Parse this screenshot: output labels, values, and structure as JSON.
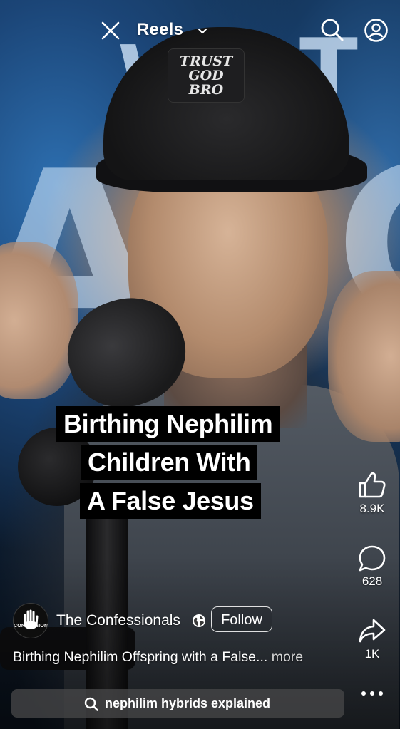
{
  "topbar": {
    "title": "Reels",
    "icons": [
      "close-icon",
      "chevron-down-icon",
      "search-icon",
      "profile-icon"
    ]
  },
  "video": {
    "cap_text": "TRUST\nGOD\nBRO",
    "background_letters": [
      "W",
      "A",
      "T",
      "T",
      "C"
    ]
  },
  "caption": {
    "lines": [
      "Birthing Nephilim",
      "Children With",
      "A False Jesus"
    ]
  },
  "actions": {
    "like": {
      "icon": "thumbs-up-icon",
      "count": "8.9K"
    },
    "comment": {
      "icon": "comment-icon",
      "count": "628"
    },
    "share": {
      "icon": "share-icon",
      "count": "1K"
    },
    "more": {
      "icon": "more-icon"
    }
  },
  "author": {
    "name": "The Confessionals",
    "avatar_text": "CONFESSIONALS",
    "follow_label": "Follow",
    "privacy_icon": "globe-icon"
  },
  "description": {
    "text": "Birthing Nephilim Offspring with a False...",
    "more_label": "more"
  },
  "search_suggestion": {
    "icon": "search-icon",
    "text": "nephilim hybrids explained"
  },
  "colors": {
    "overlay_text": "#ffffff",
    "caption_bg": "#000000",
    "pill_bg": "#464648"
  }
}
